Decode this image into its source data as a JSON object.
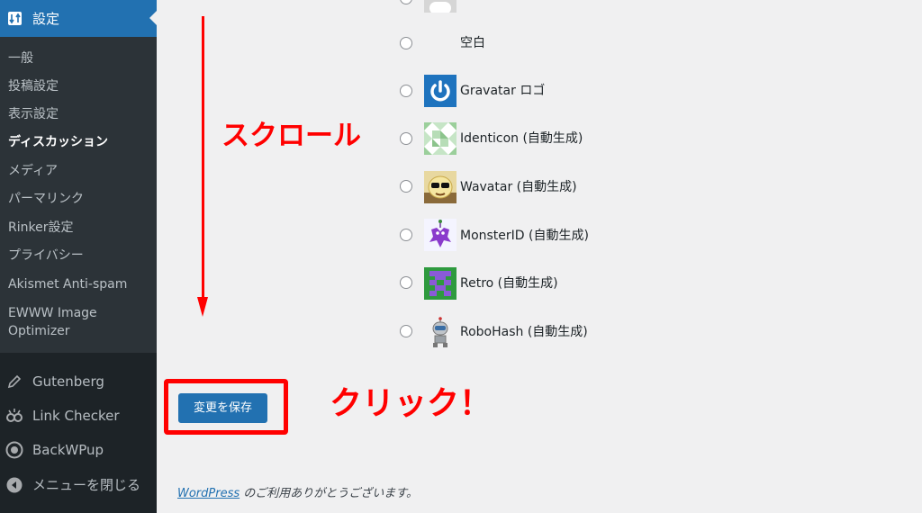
{
  "sidebar": {
    "section_title": "設定",
    "submenu": [
      "一般",
      "投稿設定",
      "表示設定",
      "ディスカッション",
      "メディア",
      "パーマリンク",
      "Rinker設定",
      "プライバシー",
      "Akismet Anti-spam",
      "EWWW Image Optimizer"
    ],
    "current_item": "ディスカッション",
    "plugins": [
      "Gutenberg",
      "Link Checker",
      "BackWPup"
    ],
    "collapse_label": "メニューを閉じる"
  },
  "avatar_options": [
    {
      "label": "空白",
      "icon": "blank-avatar"
    },
    {
      "label": "Gravatar ロゴ",
      "icon": "gravatar-logo-icon"
    },
    {
      "label": "Identicon (自動生成)",
      "icon": "identicon-icon"
    },
    {
      "label": "Wavatar (自動生成)",
      "icon": "wavatar-icon"
    },
    {
      "label": "MonsterID (自動生成)",
      "icon": "monsterid-icon"
    },
    {
      "label": "Retro (自動生成)",
      "icon": "retro-icon"
    },
    {
      "label": "RoboHash (自動生成)",
      "icon": "robohash-icon"
    }
  ],
  "annotations": {
    "scroll": "スクロール",
    "click": "クリック！"
  },
  "save_button": "変更を保存",
  "footer": {
    "link": "WordPress",
    "text": " のご利用ありがとうございます。"
  },
  "colors": {
    "sidebar_bg": "#1d2327",
    "submenu_bg": "#2c3338",
    "accent": "#2271b1",
    "annotation": "#ff0000",
    "content_bg": "#f0f0f1"
  }
}
